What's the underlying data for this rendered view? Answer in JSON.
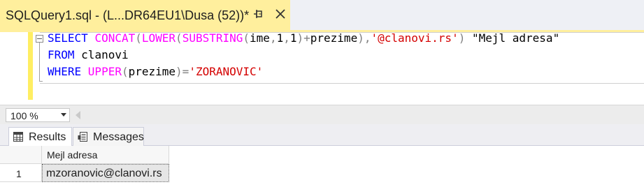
{
  "window": {
    "tab_title": "SQLQuery1.sql - (L...DR64EU1\\Dusa (52))*"
  },
  "editor": {
    "lines": [
      {
        "tokens": [
          {
            "text": "SELECT ",
            "kind": "kw"
          },
          {
            "text": "CONCAT",
            "kind": "fn"
          },
          {
            "text": "(",
            "kind": "op"
          },
          {
            "text": "LOWER",
            "kind": "fn"
          },
          {
            "text": "(",
            "kind": "op"
          },
          {
            "text": "SUBSTRING",
            "kind": "fn"
          },
          {
            "text": "(",
            "kind": "op"
          },
          {
            "text": "ime",
            "kind": "id"
          },
          {
            "text": ",",
            "kind": "op"
          },
          {
            "text": "1",
            "kind": "id"
          },
          {
            "text": ",",
            "kind": "op"
          },
          {
            "text": "1",
            "kind": "id"
          },
          {
            "text": ")+",
            "kind": "op"
          },
          {
            "text": "prezime",
            "kind": "id"
          },
          {
            "text": "),",
            "kind": "op"
          },
          {
            "text": "'@clanovi.rs'",
            "kind": "str"
          },
          {
            "text": ") ",
            "kind": "op"
          },
          {
            "text": "\"Mejl adresa\"",
            "kind": "id"
          }
        ]
      },
      {
        "tokens": [
          {
            "text": "FROM ",
            "kind": "kw"
          },
          {
            "text": "clanovi",
            "kind": "id"
          }
        ]
      },
      {
        "tokens": [
          {
            "text": "WHERE ",
            "kind": "kw"
          },
          {
            "text": "UPPER",
            "kind": "fn"
          },
          {
            "text": "(",
            "kind": "op"
          },
          {
            "text": "prezime",
            "kind": "id"
          },
          {
            "text": ")=",
            "kind": "op"
          },
          {
            "text": "'ZORANOVIC'",
            "kind": "str"
          }
        ]
      }
    ]
  },
  "zoom": {
    "value": "100 %"
  },
  "results": {
    "tabs": [
      {
        "label": "Results",
        "icon": "grid-icon",
        "active": true
      },
      {
        "label": "Messages",
        "icon": "messages-icon",
        "active": false
      }
    ],
    "columns": [
      "Mejl adresa"
    ],
    "rows": [
      {
        "num": "1",
        "cells": [
          "mzoranovic@clanovi.rs"
        ]
      }
    ]
  },
  "colors": {
    "keyword": "#0000ff",
    "function": "#ff00ff",
    "string": "#d40000",
    "operator": "#808080",
    "tab_background": "#ffef9d"
  }
}
